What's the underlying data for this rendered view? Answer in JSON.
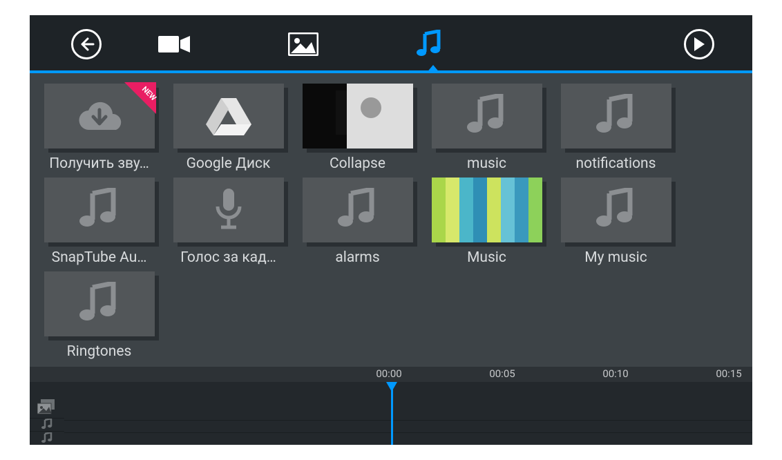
{
  "header": {
    "tabs": [
      "video",
      "image",
      "music"
    ],
    "active_tab": "music"
  },
  "badge_new": "NEW",
  "albums": [
    {
      "id": "get-sound",
      "label": "Получить зву…",
      "icon": "cloud-download",
      "new": true
    },
    {
      "id": "google-drive",
      "label": "Google Диск",
      "icon": "drive"
    },
    {
      "id": "collapse",
      "label": "Collapse",
      "icon": "photo"
    },
    {
      "id": "music",
      "label": "music",
      "icon": "note"
    },
    {
      "id": "notifications",
      "label": "notifications",
      "icon": "note"
    },
    {
      "id": "snaptube",
      "label": "SnapTube Au…",
      "icon": "note"
    },
    {
      "id": "voiceover",
      "label": "Голос за кад…",
      "icon": "mic"
    },
    {
      "id": "alarms",
      "label": "alarms",
      "icon": "note"
    },
    {
      "id": "music2",
      "label": "Music",
      "icon": "bars"
    },
    {
      "id": "my-music",
      "label": "My music",
      "icon": "note"
    },
    {
      "id": "ringtones",
      "label": "Ringtones",
      "icon": "note"
    }
  ],
  "timeline": {
    "ticks": [
      "00:00",
      "00:05",
      "00:10",
      "00:15"
    ],
    "tick_spacing_px": 164,
    "playhead_label": "00:00",
    "tracks": [
      "video",
      "music1",
      "music2"
    ]
  },
  "colors": {
    "accent": "#0099ff",
    "ribbon": "#e91e63"
  },
  "bars_colors": [
    "#aad64a",
    "#d7e86b",
    "#4bb6c9",
    "#2f8fb5",
    "#cde35e",
    "#66c2d6",
    "#3a99bd",
    "#8dd15a"
  ]
}
